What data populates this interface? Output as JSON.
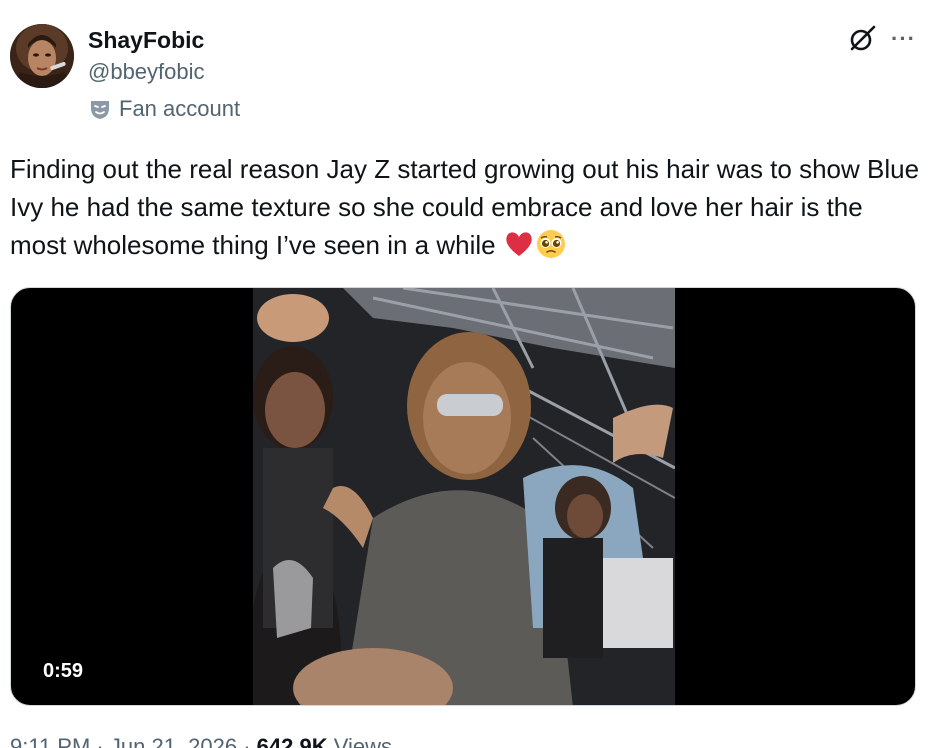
{
  "author": {
    "display_name": "ShayFobic",
    "handle": "@bbeyfobic",
    "label": "Fan account",
    "label_icon": "theater-mask-icon",
    "avatar_icon": "profile-photo"
  },
  "actions": {
    "grok_icon": "grok-icon",
    "more_label": "···"
  },
  "tweet": {
    "text": "Finding out the real reason Jay Z started growing out his hair was to show Blue Ivy he had the same texture so she could embrace and love her hair is the most wholesome thing I’ve seen in a while ",
    "emojis": [
      "red-heart",
      "pleading-face"
    ]
  },
  "media": {
    "type": "video",
    "duration": "0:59"
  },
  "meta": {
    "time": "9:11 PM",
    "sep1": " · ",
    "date": "Jun 21, 2026",
    "sep2": " · ",
    "views_count": "642.9K",
    "views_label": " Views"
  },
  "colors": {
    "text_primary": "#0f1419",
    "text_secondary": "#536471",
    "media_bg": "#000000"
  }
}
